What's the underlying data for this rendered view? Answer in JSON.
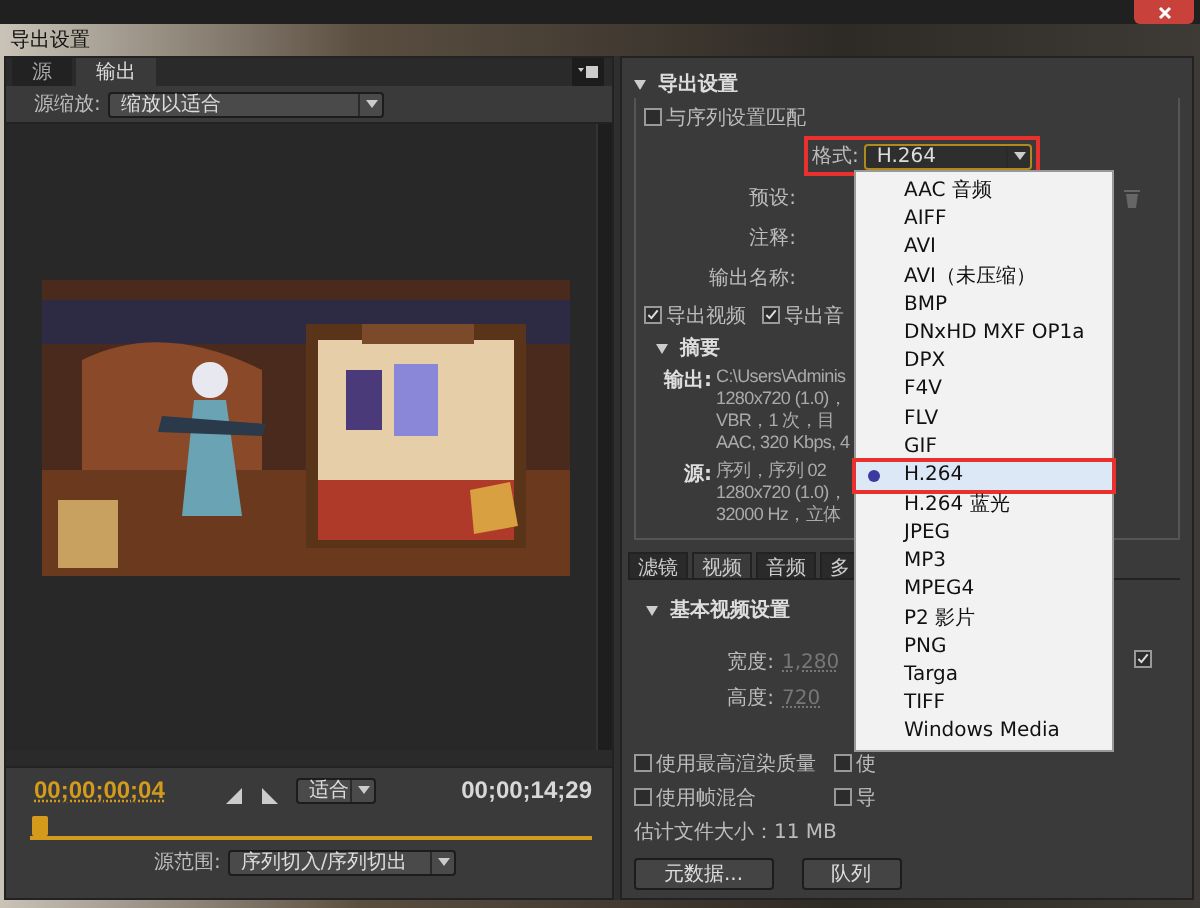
{
  "window": {
    "title": "导出设置"
  },
  "source_panel": {
    "tabs": [
      {
        "label": "源",
        "selected": false
      },
      {
        "label": "输出",
        "selected": true
      }
    ],
    "scale": {
      "label": "源缩放:",
      "value": "缩放以适合"
    },
    "current_time": "00;00;00;04",
    "zoom": {
      "value": "适合"
    },
    "duration": "00;00;14;29",
    "playhead": {
      "level": 0.01
    },
    "range": {
      "label": "源范围:",
      "value": "序列切入/序列切出"
    }
  },
  "export_settings": {
    "heading": "导出设置",
    "match_sequence": {
      "label": "与序列设置匹配",
      "checked": false
    },
    "format": {
      "label": "格式:",
      "value": "H.264",
      "highlighted": true
    },
    "preset": {
      "label": "预设:"
    },
    "comments": {
      "label": "注释:"
    },
    "output_name": {
      "label": "输出名称:"
    },
    "export_video": {
      "label": "导出视频",
      "checked": true
    },
    "export_audio": {
      "label": "导出音",
      "checked": true
    },
    "summary": {
      "heading": "摘要",
      "output": {
        "label": "输出:",
        "lines": [
          "C:\\Users\\Adminis",
          "1280x720 (1.0)，",
          "VBR，1 次，目",
          "AAC, 320 Kbps, 4"
        ]
      },
      "source": {
        "label": "源:",
        "lines": [
          "序列，序列 02",
          "1280x720 (1.0)，",
          "32000 Hz，立体"
        ]
      }
    }
  },
  "settings_tabs": [
    {
      "label": "滤镜",
      "selected": false
    },
    {
      "label": "视频",
      "selected": true
    },
    {
      "label": "音频",
      "selected": false
    },
    {
      "label": "多",
      "selected": false
    }
  ],
  "video": {
    "heading": "基本视频设置",
    "width": {
      "label": "宽度:",
      "value": "1,280"
    },
    "height": {
      "label": "高度:",
      "value": "720"
    },
    "lock": {
      "checked": true
    }
  },
  "options": [
    {
      "label": "使用最高渲染质量",
      "checked": false
    },
    {
      "label": "使",
      "checked": false
    },
    {
      "label": "使用帧混合",
      "checked": false
    },
    {
      "label": "导",
      "checked": false
    }
  ],
  "file_size": "估计文件大小：11 MB",
  "buttons": [
    {
      "label": "元数据..."
    },
    {
      "label": "队列"
    }
  ],
  "format_menu": [
    {
      "label": "AAC 音频",
      "selected": false,
      "highlighted": false
    },
    {
      "label": "AIFF",
      "selected": false,
      "highlighted": false
    },
    {
      "label": "AVI",
      "selected": false,
      "highlighted": false
    },
    {
      "label": "AVI（未压缩）",
      "selected": false,
      "highlighted": false
    },
    {
      "label": "BMP",
      "selected": false,
      "highlighted": false
    },
    {
      "label": "DNxHD MXF OP1a",
      "selected": false,
      "highlighted": false
    },
    {
      "label": "DPX",
      "selected": false,
      "highlighted": false
    },
    {
      "label": "F4V",
      "selected": false,
      "highlighted": false
    },
    {
      "label": "FLV",
      "selected": false,
      "highlighted": false
    },
    {
      "label": "GIF",
      "selected": false,
      "highlighted": false
    },
    {
      "label": "H.264",
      "selected": true,
      "highlighted": true
    },
    {
      "label": "H.264 蓝光",
      "selected": false,
      "highlighted": false
    },
    {
      "label": "JPEG",
      "selected": false,
      "highlighted": false
    },
    {
      "label": "MP3",
      "selected": false,
      "highlighted": false
    },
    {
      "label": "MPEG4",
      "selected": false,
      "highlighted": false
    },
    {
      "label": "P2 影片",
      "selected": false,
      "highlighted": false
    },
    {
      "label": "PNG",
      "selected": false,
      "highlighted": false
    },
    {
      "label": "Targa",
      "selected": false,
      "highlighted": false
    },
    {
      "label": "TIFF",
      "selected": false,
      "highlighted": false
    },
    {
      "label": "Windows Media",
      "selected": false,
      "highlighted": false
    }
  ]
}
